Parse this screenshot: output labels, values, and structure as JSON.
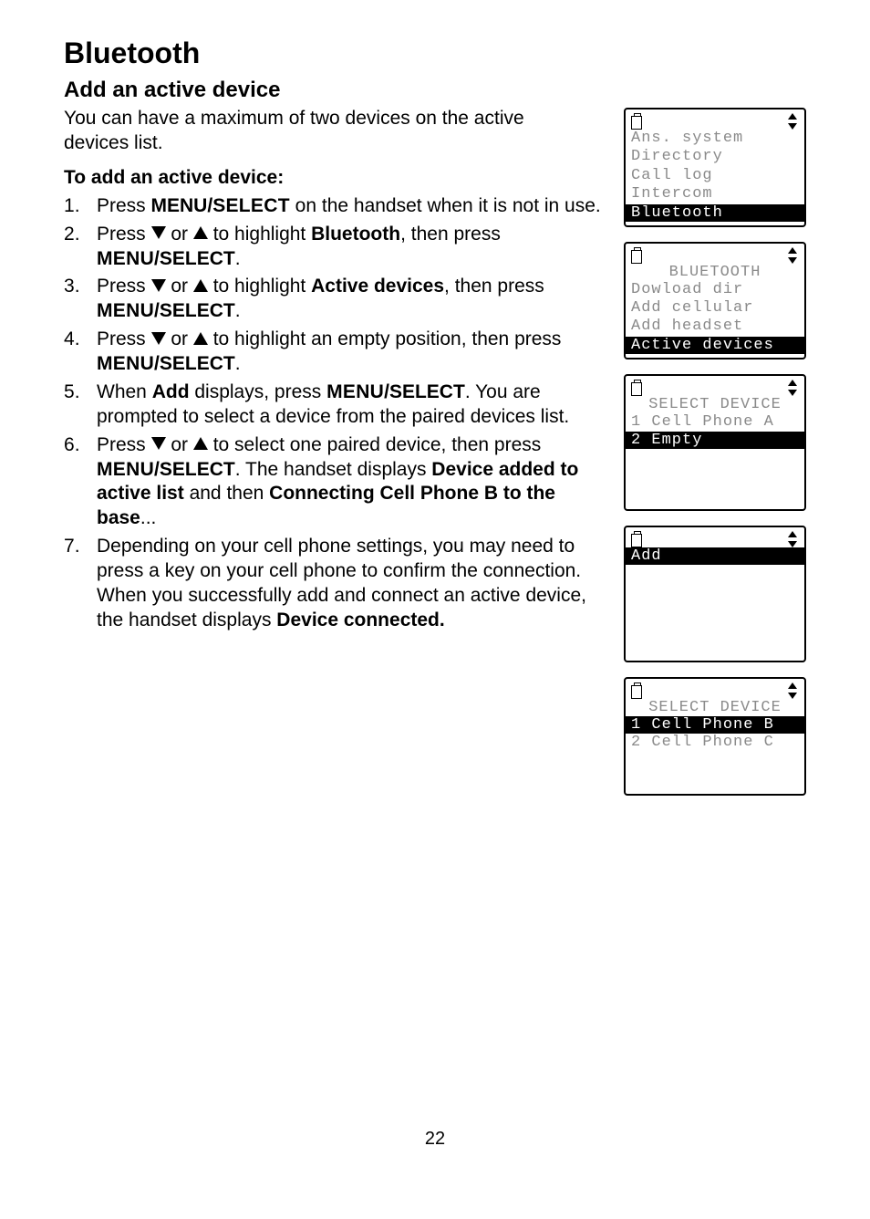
{
  "page_number": "22",
  "heading": "Bluetooth",
  "subheading": "Add an active device",
  "intro": "You can have a maximum of two devices on the active devices list.",
  "subhead": "To add an active device:",
  "steps": {
    "s1a": "Press ",
    "s1b": "MENU/",
    "s1c": "SELECT",
    "s1d": " on the handset when it is not in use.",
    "s2a": "Press ",
    "s2b": " or ",
    "s2c": " to highlight ",
    "s2d": "Bluetooth",
    "s2e": ", then press ",
    "s2f": "MENU",
    "s2g": "/SELECT",
    "s2h": ".",
    "s3a": "Press ",
    "s3b": " or ",
    "s3c": " to highlight ",
    "s3d": "Active devices",
    "s3e": ", then press ",
    "s3f": "MENU",
    "s3g": "/SELECT",
    "s3h": ".",
    "s4a": "Press ",
    "s4b": " or ",
    "s4c": " to highlight an empty position, then press ",
    "s4d": "MENU",
    "s4e": "/SELECT",
    "s4f": ".",
    "s5a": "When ",
    "s5b": "Add",
    "s5c": " displays, press ",
    "s5d": "MENU",
    "s5e": "/SELECT",
    "s5f": ". You are prompted to select a device from the paired devices list.",
    "s6a": "Press ",
    "s6b": " or ",
    "s6c": " to select one paired device, then press ",
    "s6d": "MENU",
    "s6e": "/SELECT",
    "s6f": ". The handset displays ",
    "s6g": "Device added to active list",
    "s6h": " and then ",
    "s6i": "Connecting Cell Phone B to the base",
    "s6j": "...",
    "s7a": "Depending on your cell phone settings, you may need to press a key on your cell phone to confirm the connection. When you successfully add and connect an active device, the handset displays ",
    "s7b": "Device connected."
  },
  "lcd1": {
    "l1": "Ans. system",
    "l2": "Directory",
    "l3": "Call log",
    "l4": "Intercom",
    "sel": "Bluetooth"
  },
  "lcd2": {
    "title": "BLUETOOTH",
    "l1": "Dowload dir",
    "l2": "Add cellular",
    "l3": "Add headset",
    "sel": "Active devices"
  },
  "lcd3": {
    "title": "SELECT DEVICE",
    "l1": "1 Cell Phone A",
    "sel": "2 Empty"
  },
  "lcd4": {
    "sel": "Add"
  },
  "lcd5": {
    "title": "SELECT DEVICE",
    "sel": "1 Cell Phone B",
    "l2": "2 Cell Phone C"
  }
}
